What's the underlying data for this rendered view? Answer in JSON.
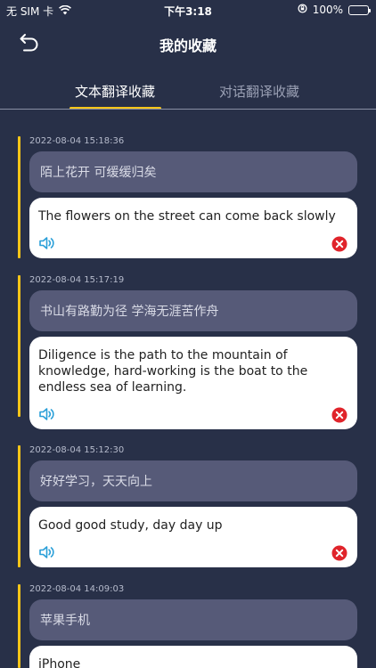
{
  "status_bar": {
    "carrier": "无 SIM 卡",
    "time": "下午3:18",
    "battery": "100%"
  },
  "nav": {
    "title": "我的收藏"
  },
  "tabs": [
    {
      "label": "文本翻译收藏",
      "active": true
    },
    {
      "label": "对话翻译收藏",
      "active": false
    }
  ],
  "favorites": [
    {
      "timestamp": "2022-08-04 15:18:36",
      "source": "陌上花开 可缓缓归矣",
      "translation": "The flowers on the street can come back slowly"
    },
    {
      "timestamp": "2022-08-04 15:17:19",
      "source": "书山有路勤为径 学海无涯苦作舟",
      "translation": "Diligence is the path to the mountain of knowledge, hard-working is the boat to the endless sea of learning."
    },
    {
      "timestamp": "2022-08-04 15:12:30",
      "source": "好好学习，天天向上",
      "translation": "Good good study, day day up"
    },
    {
      "timestamp": "2022-08-04 14:09:03",
      "source": "苹果手机",
      "translation": "iPhone"
    }
  ],
  "colors": {
    "background": "#283048",
    "accent": "#f5c518",
    "source_box": "#565a78",
    "speaker_icon": "#2a9fd8",
    "delete_icon": "#e0242b"
  }
}
